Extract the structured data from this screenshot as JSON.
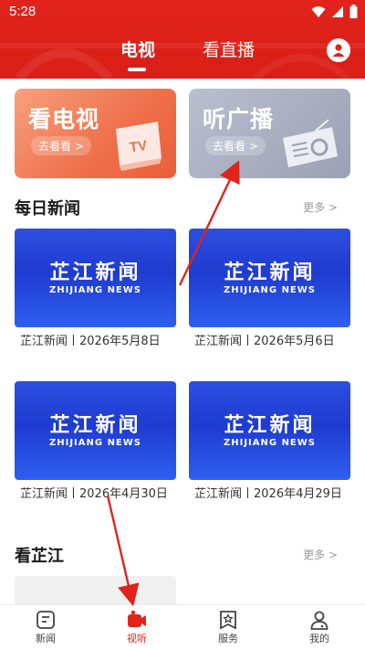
{
  "status_bar": {
    "time": "5:28"
  },
  "header": {
    "tabs": [
      {
        "label": "电视",
        "active": true
      },
      {
        "label": "看直播",
        "active": false
      }
    ]
  },
  "features": [
    {
      "title": "看电视",
      "action": "去看看 >",
      "graphic_label": "TV"
    },
    {
      "title": "听广播",
      "action": "去看看 >"
    }
  ],
  "daily_news": {
    "title": "每日新闻",
    "more": "更多 >",
    "items": [
      {
        "thumb_cn": "芷江新闻",
        "thumb_en": "ZHIJIANG NEWS",
        "caption": "芷江新闻丨2026年5月8日"
      },
      {
        "thumb_cn": "芷江新闻",
        "thumb_en": "ZHIJIANG NEWS",
        "caption": "芷江新闻丨2026年5月6日"
      },
      {
        "thumb_cn": "芷江新闻",
        "thumb_en": "ZHIJIANG NEWS",
        "caption": "芷江新闻丨2026年4月30日"
      },
      {
        "thumb_cn": "芷江新闻",
        "thumb_en": "ZHIJIANG NEWS",
        "caption": "芷江新闻丨2026年4月29日"
      }
    ]
  },
  "kan_zhijiang": {
    "title": "看芷江",
    "more": "更多 >"
  },
  "bottom_nav": [
    {
      "label": "新闻",
      "icon": "news-icon",
      "active": false
    },
    {
      "label": "视听",
      "icon": "video-camera-icon",
      "active": true
    },
    {
      "label": "服务",
      "icon": "service-icon",
      "active": false
    },
    {
      "label": "我的",
      "icon": "profile-icon",
      "active": false
    }
  ],
  "colors": {
    "brand": "#e0241c",
    "thumb_blue": "#2447d8",
    "annotation_arrow": "#e0241c"
  }
}
